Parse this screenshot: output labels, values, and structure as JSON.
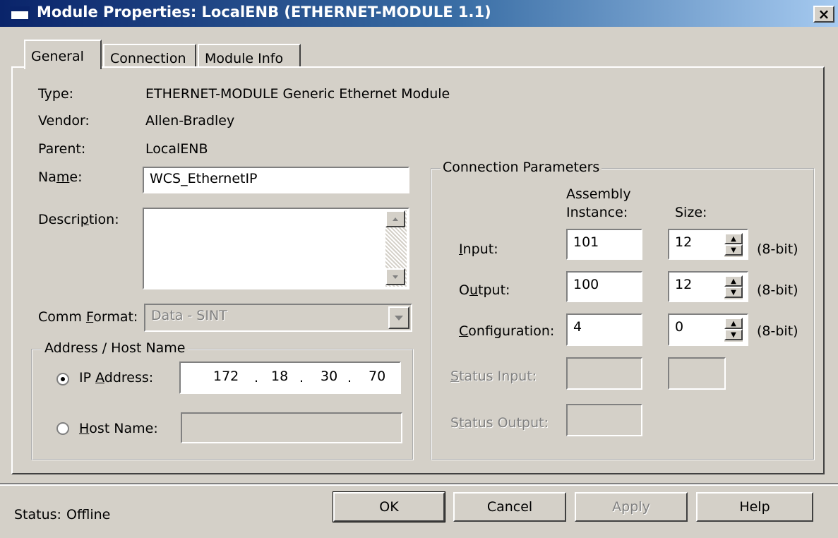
{
  "window": {
    "title": "Module Properties: LocalENB (ETHERNET-MODULE 1.1)",
    "close_label": "×"
  },
  "tabs": [
    {
      "label": "General",
      "active": true
    },
    {
      "label": "Connection",
      "active": false
    },
    {
      "label": "Module Info",
      "active": false
    }
  ],
  "general": {
    "type_label": "Type:",
    "type_value": "ETHERNET-MODULE Generic Ethernet Module",
    "vendor_label": "Vendor:",
    "vendor_value": "Allen-Bradley",
    "parent_label": "Parent:",
    "parent_value": "LocalENB",
    "name_label_pre": "Na",
    "name_label_u": "m",
    "name_label_post": "e:",
    "name_value": "WCS_EthernetIP",
    "description_label_pre": "Descri",
    "description_label_u": "p",
    "description_label_post": "tion:",
    "description_value": "",
    "comm_format_label_pre": "Comm ",
    "comm_format_label_u": "F",
    "comm_format_label_post": "ormat:",
    "comm_format_value": "Data - SINT"
  },
  "address": {
    "legend": "Address / Host Name",
    "ip_label_pre": "IP ",
    "ip_label_u": "A",
    "ip_label_post": "ddress:",
    "ip_octets": [
      "172",
      "18",
      "30",
      "70"
    ],
    "ip_dot": ".",
    "host_label_pre": "",
    "host_label_u": "H",
    "host_label_post": "ost Name:",
    "host_value": "",
    "selected": "ip"
  },
  "connection_parameters": {
    "legend": "Connection Parameters",
    "assembly_header_line1": "Assembly",
    "assembly_header_line2": "Instance:",
    "size_header": "Size:",
    "unit": "(8-bit)",
    "input_label_u": "I",
    "input_label_post": "nput:",
    "input_instance": "101",
    "input_size": "12",
    "output_label_pre": "O",
    "output_label_u": "u",
    "output_label_post": "tput:",
    "output_instance": "100",
    "output_size": "12",
    "config_label_u": "C",
    "config_label_post": "onfiguration:",
    "config_instance": "4",
    "config_size": "0",
    "status_input_label_u": "S",
    "status_input_label_post": "tatus Input:",
    "status_output_label_pre": "S",
    "status_output_label_u": "t",
    "status_output_label_post": "atus Output:"
  },
  "footer": {
    "status_label": "Status:",
    "status_value": "Offline",
    "ok_label": "OK",
    "cancel_label": "Cancel",
    "apply_label": "Apply",
    "help_label": "Help"
  }
}
